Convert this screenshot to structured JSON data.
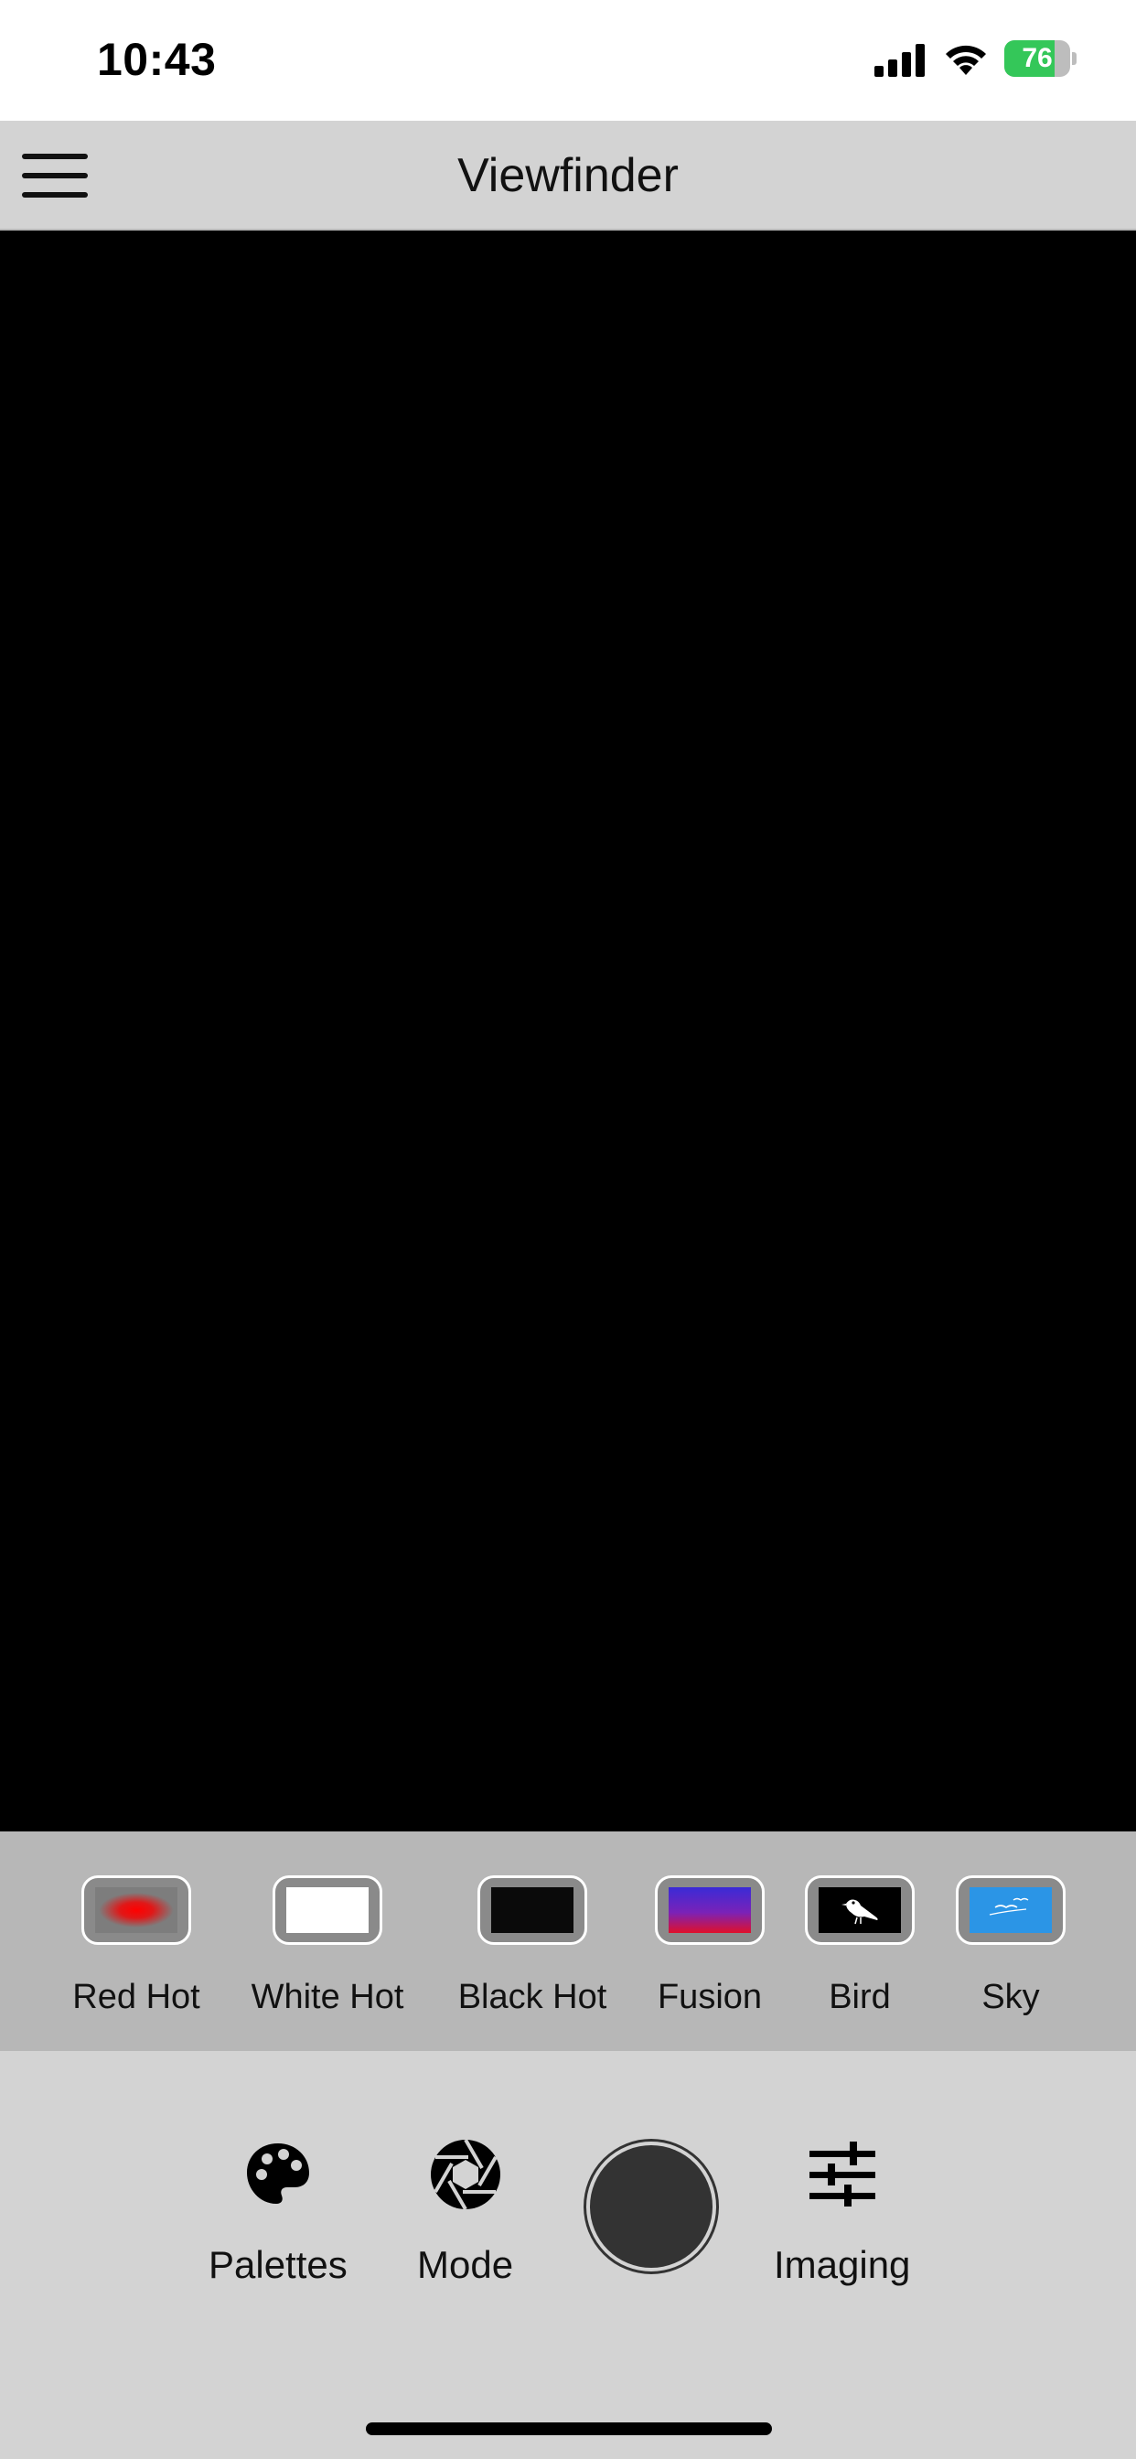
{
  "status_bar": {
    "time": "10:43",
    "battery_percent": "76",
    "battery_level": 0.76,
    "icons": [
      "cellular-signal-icon",
      "wifi-icon",
      "battery-charging-icon"
    ]
  },
  "nav": {
    "title": "Viewfinder",
    "menu_icon": "hamburger-menu-icon"
  },
  "palettes": [
    {
      "label": "Red Hot",
      "thumb": "red-hot-swatch",
      "colors": [
        "#7d7d7d",
        "#ff0000"
      ]
    },
    {
      "label": "White Hot",
      "thumb": "white-hot-swatch",
      "colors": [
        "#ffffff"
      ]
    },
    {
      "label": "Black Hot",
      "thumb": "black-hot-swatch",
      "colors": [
        "#0a0a0a"
      ]
    },
    {
      "label": "Fusion",
      "thumb": "fusion-swatch",
      "colors": [
        "#3a2bd6",
        "#e0102a"
      ]
    },
    {
      "label": "Bird",
      "thumb": "bird-swatch",
      "colors": [
        "#000000",
        "#ffffff"
      ]
    },
    {
      "label": "Sky",
      "thumb": "sky-swatch",
      "colors": [
        "#2b95e6",
        "#ffffff"
      ]
    }
  ],
  "toolbar": {
    "palettes_label": "Palettes",
    "mode_label": "Mode",
    "imaging_label": "Imaging",
    "palettes_icon": "palette-icon",
    "mode_icon": "aperture-icon",
    "imaging_icon": "sliders-icon",
    "shutter_color": "#333333"
  },
  "colors": {
    "nav_bg": "#d3d3d3",
    "strip_bg": "#b7b7b7",
    "viewfinder_bg": "#000000"
  }
}
